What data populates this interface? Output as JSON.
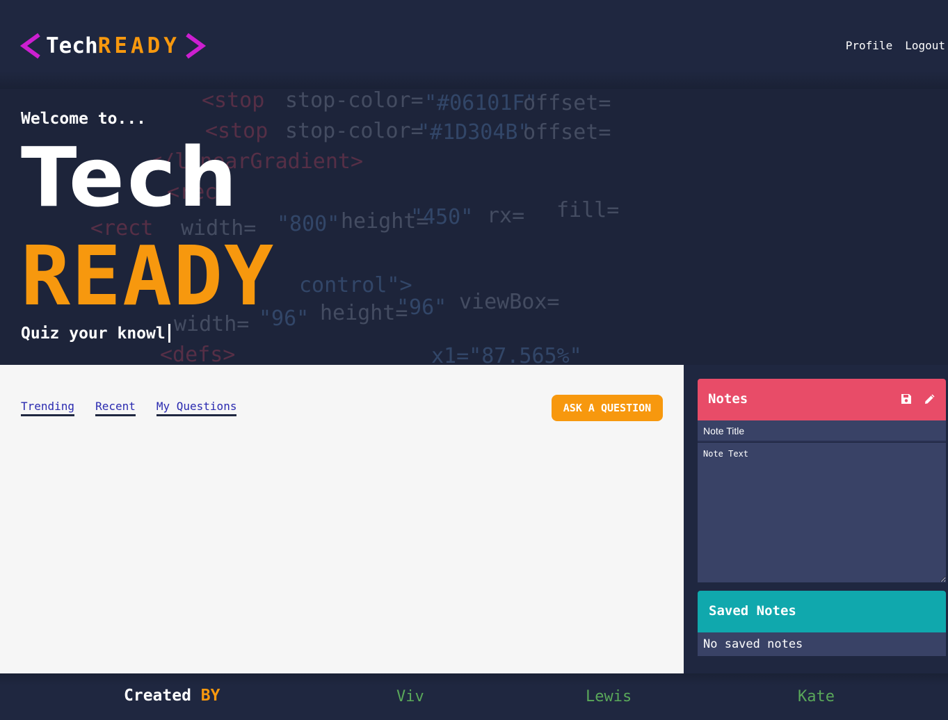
{
  "header": {
    "logo_tech": "Tech",
    "logo_ready": "READY",
    "nav": [
      "Profile",
      "Logout"
    ]
  },
  "hero": {
    "welcome": "Welcome to...",
    "title_line1": "Tech",
    "title_line2": "READY",
    "tagline": "Quiz your knowl"
  },
  "main": {
    "tabs": [
      "Trending",
      "Recent",
      "My Questions"
    ],
    "ask_button": "ASK A QUESTION"
  },
  "notes": {
    "title": "Notes",
    "title_placeholder": "Note Title",
    "text_placeholder": "Note Text",
    "save_icon": "floppy-disk-icon",
    "edit_icon": "pencil-icon"
  },
  "saved_notes": {
    "title": "Saved Notes",
    "empty_text": "No saved notes"
  },
  "footer": {
    "created": "Created",
    "by": "BY",
    "authors": [
      "Viv",
      "Lewis",
      "Kate"
    ]
  },
  "colors": {
    "background": "#1f2740",
    "accent_orange": "#f7980e",
    "logo_magenta": "#cc1fd0",
    "notes_header": "#e84c68",
    "saved_header": "#10a8ad",
    "input_bg": "#394266",
    "author_green": "#5aa85a"
  }
}
